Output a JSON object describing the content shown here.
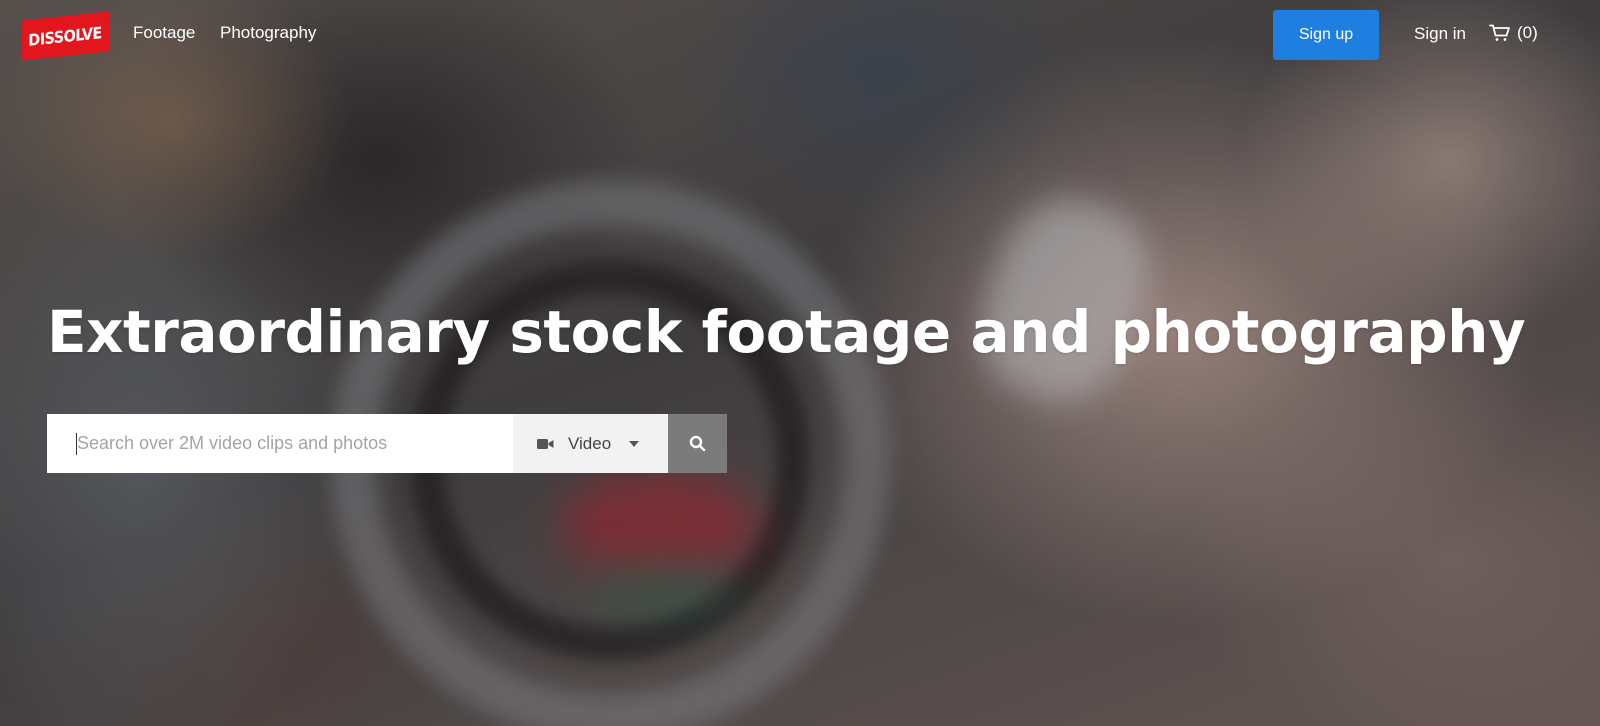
{
  "brand": {
    "logo_text": "DISSOLVE",
    "logo_color": "#e4161d"
  },
  "nav": {
    "items": [
      {
        "label": "Footage"
      },
      {
        "label": "Photography"
      }
    ]
  },
  "account": {
    "signup_label": "Sign up",
    "signup_color": "#1f7fe0",
    "signin_label": "Sign in",
    "cart_count": "(0)",
    "cart_icon": "cart-icon"
  },
  "hero": {
    "headline": "Extraordinary stock footage and photography"
  },
  "search": {
    "placeholder": "Search over 2M video clips and photos",
    "value": "",
    "media_type": {
      "selected": "Video",
      "icon": "video-camera-icon"
    },
    "submit_icon": "search-icon",
    "submit_color": "#7b7b7b"
  }
}
